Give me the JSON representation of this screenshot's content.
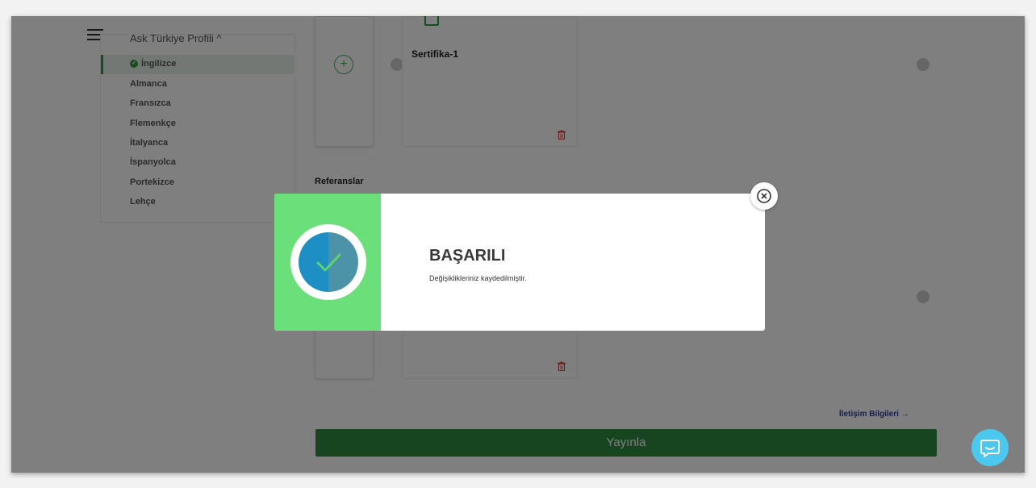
{
  "sidebar": {
    "profile_title": "Ask Türkiye Profili ^",
    "languages": [
      "İngilizce",
      "Almanca",
      "Fransızca",
      "Flemenkçe",
      "İtalyanca",
      "İspanyolca",
      "Portekizce",
      "Lehçe"
    ],
    "active_language": "İngilizce"
  },
  "certificates": {
    "card_title": "Sertifika-1",
    "add_icon": "plus-circle-icon",
    "delete_icon": "trash-icon"
  },
  "references": {
    "label": "Referanslar"
  },
  "footer": {
    "contact_link": "İletişim Bilgileri →",
    "publish_button": "Yayınla",
    "chat_icon": "chat-bubble-icon"
  },
  "modal": {
    "title": "BAŞARILI",
    "message": "Değişiklikleriniz kaydedilmiştir.",
    "close_icon": "close-circle-icon",
    "status_icon": "check-icon"
  },
  "colors": {
    "primary_green": "#2e8b3e",
    "success_green": "#6be07a",
    "chat_blue": "#4cc8ee",
    "link_blue": "#2b3d9c",
    "delete_red": "#e53935"
  }
}
